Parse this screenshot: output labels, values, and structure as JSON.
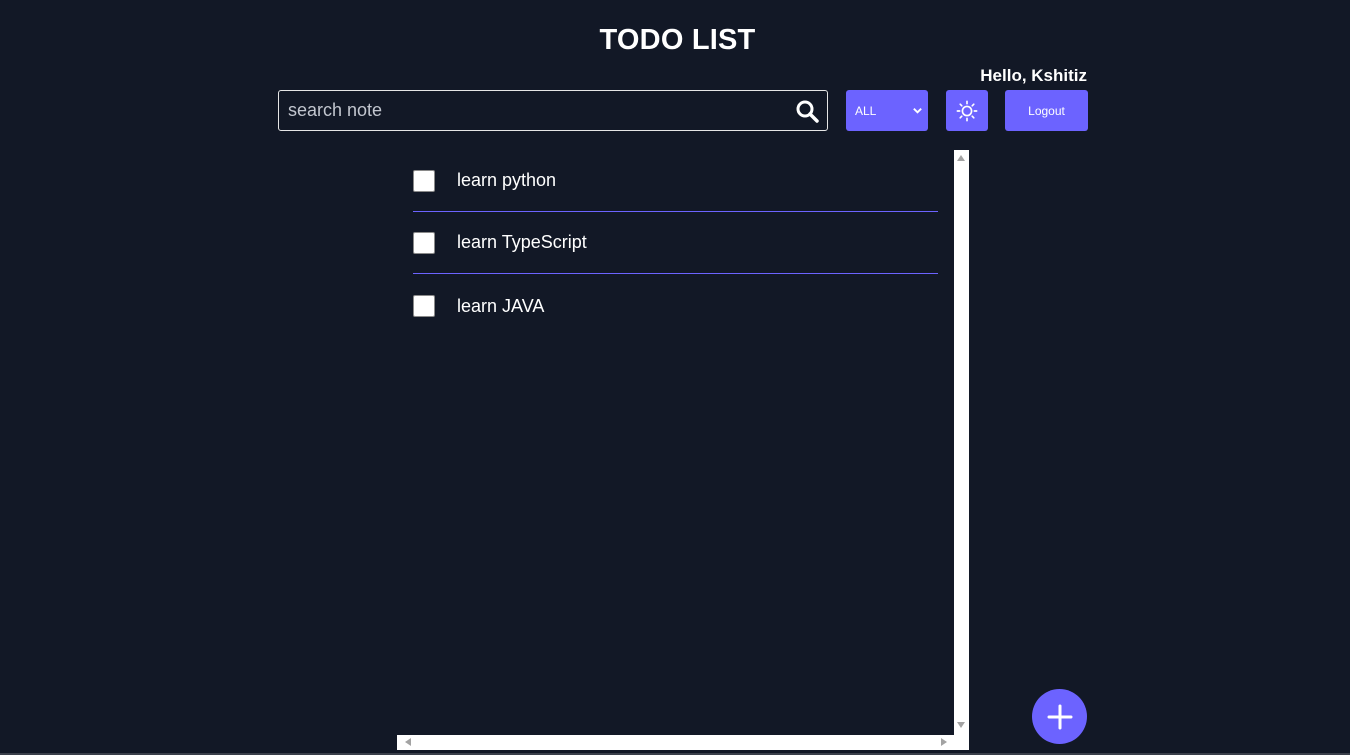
{
  "header": {
    "title": "TODO LIST",
    "greeting": "Hello, Kshitiz"
  },
  "toolbar": {
    "search": {
      "placeholder": "search note",
      "value": "",
      "icon": "search-icon"
    },
    "filter": {
      "selected": "ALL"
    },
    "theme_toggle": {
      "icon": "sun-icon"
    },
    "logout_label": "Logout"
  },
  "todos": [
    {
      "text": "learn python",
      "checked": false
    },
    {
      "text": "learn TypeScript",
      "checked": false
    },
    {
      "text": "learn JAVA",
      "checked": false
    }
  ],
  "fab": {
    "icon": "plus-icon"
  },
  "colors": {
    "background": "#121826",
    "accent": "#6c63ff",
    "text": "#ffffff"
  }
}
